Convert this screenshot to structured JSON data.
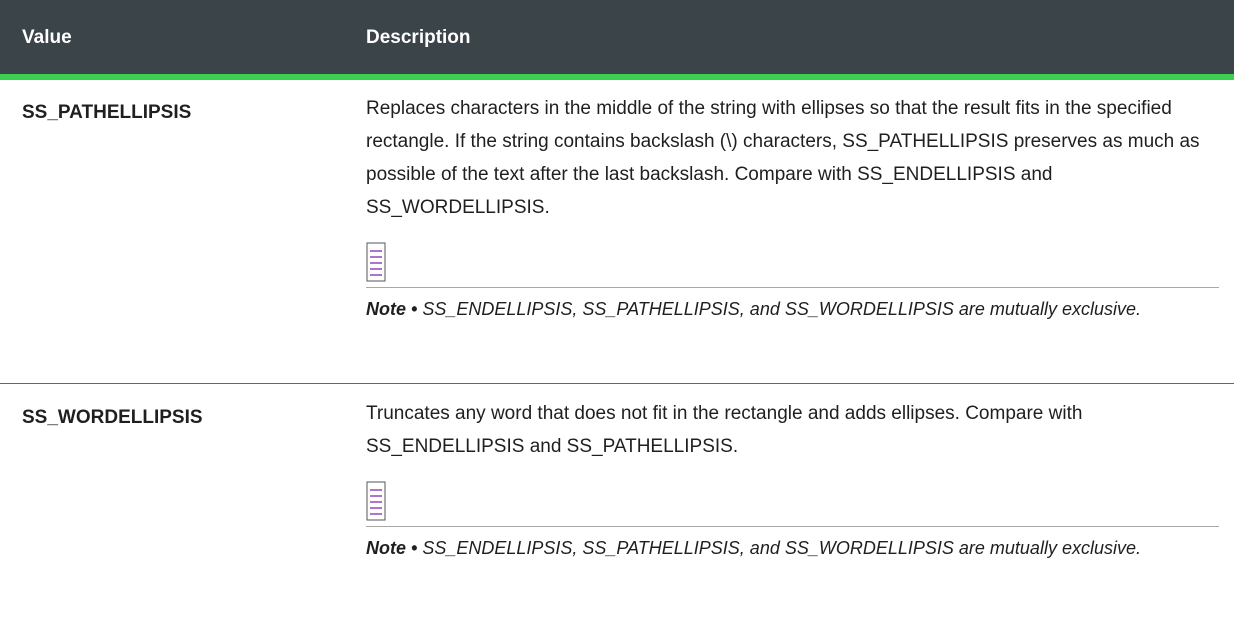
{
  "table": {
    "headers": {
      "value": "Value",
      "description": "Description"
    },
    "rows": [
      {
        "value": "SS_PATHELLIPSIS",
        "description": "Replaces characters in the middle of the string with ellipses so that the result fits in the specified rectangle. If the string contains backslash (\\) characters, SS_PATHELLIPSIS preserves as much as possible of the text after the last backslash. Compare with SS_ENDELLIPSIS and SS_WORDELLIPSIS.",
        "note_icon": "note-icon",
        "note_label": "Note •",
        "note_text": "SS_ENDELLIPSIS, SS_PATHELLIPSIS, and SS_WORDELLIPSIS are mutually exclusive."
      },
      {
        "value": "SS_WORDELLIPSIS",
        "description": "Truncates any word that does not fit in the rectangle and adds ellipses. Compare with SS_ENDELLIPSIS and SS_PATHELLIPSIS.",
        "note_icon": "note-icon",
        "note_label": "Note •",
        "note_text": "SS_ENDELLIPSIS, SS_PATHELLIPSIS, and SS_WORDELLIPSIS are mutually exclusive."
      }
    ]
  },
  "colors": {
    "header_bg": "#3a4449",
    "header_accent": "#3bd04f",
    "note_icon": "#8c3ab0"
  }
}
